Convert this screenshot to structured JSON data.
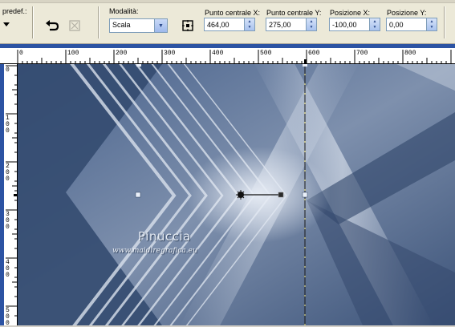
{
  "toolbar": {
    "preset_label": "predef.:",
    "mode": {
      "label": "Modalità:",
      "value": "Scala"
    },
    "center_x": {
      "label": "Punto centrale X:",
      "value": "464,00"
    },
    "center_y": {
      "label": "Punto centrale Y:",
      "value": "275,00"
    },
    "pos_x": {
      "label": "Posizione X:",
      "value": "-100,00"
    },
    "pos_y": {
      "label": "Posizione Y:",
      "value": "0,00"
    }
  },
  "ruler": {
    "h_labels": [
      "0",
      "100",
      "200",
      "300",
      "400",
      "500",
      "600",
      "700",
      "800"
    ],
    "v_labels": [
      "0",
      "100",
      "200",
      "300",
      "400",
      "500"
    ]
  },
  "canvas": {
    "watermark_name": "Pinuccia",
    "watermark_url": "www.maidiregrafica.eu"
  }
}
